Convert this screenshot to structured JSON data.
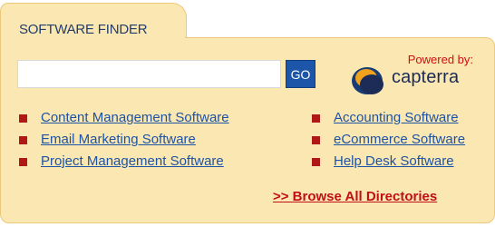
{
  "widget": {
    "title": "SOFTWARE FINDER",
    "search": {
      "value": "",
      "placeholder": "",
      "button_label": "GO"
    },
    "brand": {
      "powered_by": "Powered by:",
      "name": "capterra"
    },
    "left_links": [
      {
        "label": "Content Management Software"
      },
      {
        "label": "Email Marketing Software"
      },
      {
        "label": "Project Management Software"
      }
    ],
    "right_links": [
      {
        "label": "Accounting Software"
      },
      {
        "label": "eCommerce Software"
      },
      {
        "label": "Help Desk Software"
      }
    ],
    "browse_all": ">> Browse All Directories"
  },
  "colors": {
    "panel_background": "#fbe7b2",
    "panel_border": "#ecc97a",
    "link": "#1d53a5",
    "go_button": "#1d55a9",
    "bullet": "#b01818",
    "browse_all": "#c00f16"
  },
  "icons": {
    "brand_logo": "capterra-logo-icon",
    "list_bullet": "square-bullet-icon"
  }
}
